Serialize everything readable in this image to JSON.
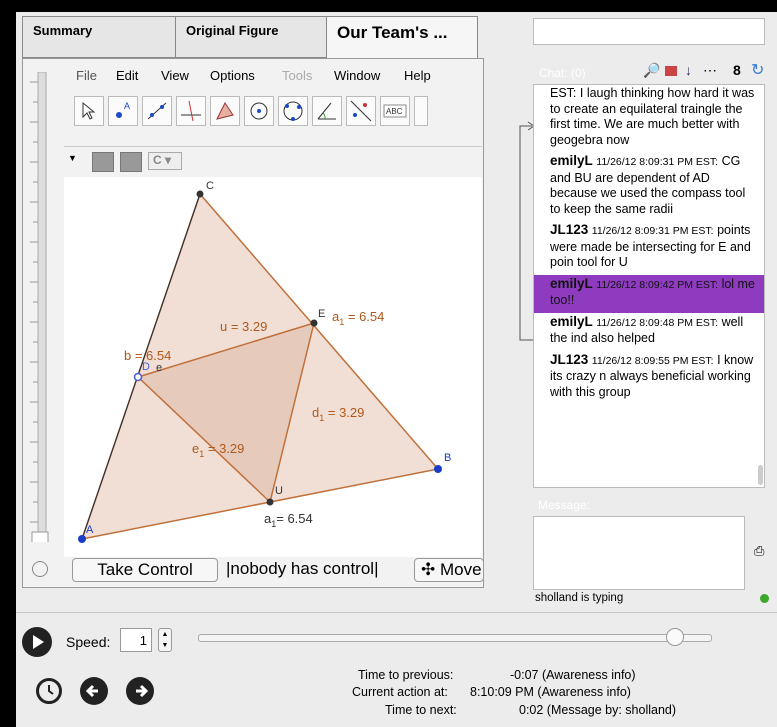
{
  "tabs": [
    {
      "label": "Summary"
    },
    {
      "label": "Original Figure"
    },
    {
      "label": "Our Team's ..."
    }
  ],
  "menu": [
    "File",
    "Edit",
    "View",
    "Options",
    "Tools",
    "Window",
    "Help"
  ],
  "toolbar": {
    "text_tool_label": "ABC"
  },
  "stylebar": {
    "mode_label": "C"
  },
  "geometry": {
    "points": {
      "A": "A",
      "B": "B",
      "C": "C",
      "E": "E",
      "U": "U",
      "D": "D",
      "e": "e"
    },
    "labels": {
      "u": "u = 3.29",
      "a1_top": "a",
      "a1_top_sub": "1",
      "a1_top_val": " = 6.54",
      "b": "b = 6.54",
      "d1": "d",
      "d1_sub": "1",
      "d1_val": " = 3.29",
      "e1": "e",
      "e1_sub": "1",
      "e1_val": " = 3.29",
      "a1_bottom": "a",
      "a1_bottom_sub": "1",
      "a1_bottom_val": "= 6.54"
    }
  },
  "controls": {
    "take_control": "Take Control",
    "status": "|nobody has control|",
    "move": "Move"
  },
  "chat": {
    "header": "Chat: (0)",
    "messages": [
      {
        "user": "",
        "ts": "",
        "text": "EST: I laugh thinking how hard it was to create an equilateral traingle the first time. We are much better with geogebra now",
        "hl": false
      },
      {
        "user": "emilyL",
        "ts": "11/26/12 8:09:31 PM EST:",
        "text": "CG and BU are dependent of AD because we used the compass tool to keep the same radii",
        "hl": false
      },
      {
        "user": "JL123",
        "ts": "11/26/12 8:09:31 PM EST:",
        "text": "points were made be intersecting for E and poin tool for U",
        "hl": false
      },
      {
        "user": "emilyL",
        "ts": "11/26/12 8:09:42 PM EST:",
        "text": "lol me too!!",
        "hl": true
      },
      {
        "user": "emilyL",
        "ts": "11/26/12 8:09:48 PM EST:",
        "text": "well the ind also helped",
        "hl": false
      },
      {
        "user": "JL123",
        "ts": "11/26/12 8:09:55 PM EST:",
        "text": "I know its crazy n always beneficial working with this group",
        "hl": false
      }
    ],
    "message_label": "Message:",
    "typing": "sholland is typing"
  },
  "playback": {
    "speed_label": "Speed:",
    "speed_value": "1",
    "slider_position": 0.93,
    "time_prev_label": "Time to previous:",
    "time_prev_value": "-0:07 (Awareness info)",
    "current_label": "Current action at:",
    "current_value": "8:10:09 PM (Awareness info)",
    "time_next_label": "Time to next:",
    "time_next_value": "0:02 (Message by: sholland)"
  },
  "colors": {
    "highlight": "#8e3bbf",
    "triangle_fill": "#f0dcd2",
    "triangle_edge": "#c0703a",
    "label_color": "#b0581c",
    "online_dot": "#3aa82a"
  }
}
